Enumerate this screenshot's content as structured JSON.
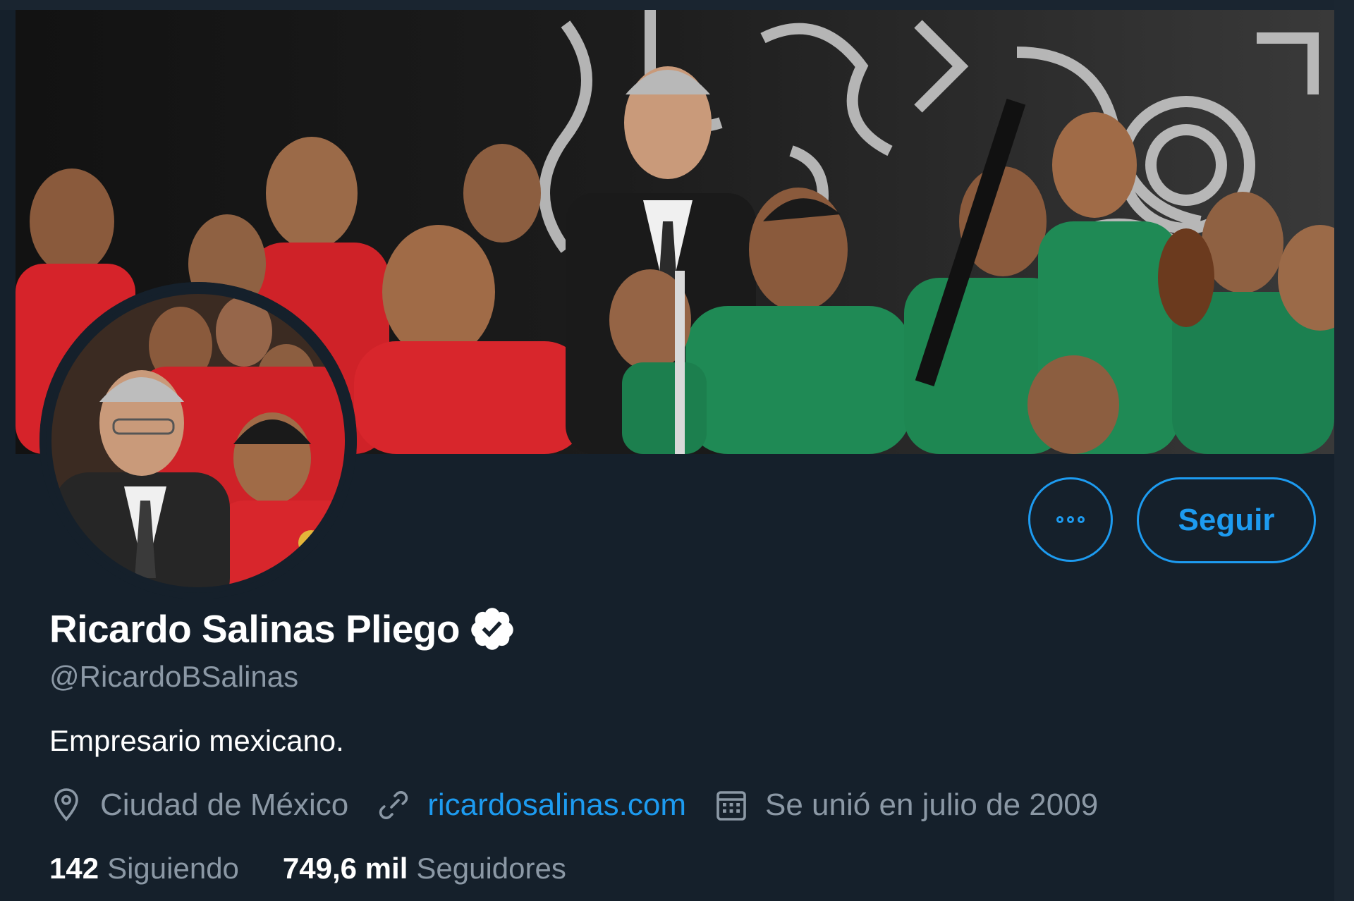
{
  "profile": {
    "display_name": "Ricardo Salinas Pliego",
    "verified": true,
    "handle": "@RicardoBSalinas",
    "bio": "Empresario mexicano.",
    "location": "Ciudad de México",
    "website": "ricardosalinas.com",
    "joined": "Se unió en julio de 2009"
  },
  "actions": {
    "more_icon": "more-options-icon",
    "follow_label": "Seguir"
  },
  "stats": {
    "following_count": "142",
    "following_label": "Siguiendo",
    "followers_count": "749,6 mil",
    "followers_label": "Seguidores"
  },
  "icons": {
    "location": "location-pin-icon",
    "link": "link-icon",
    "calendar": "calendar-icon",
    "verified": "verified-badge-icon"
  },
  "colors": {
    "background": "#15202b",
    "accent": "#1d9bf0",
    "secondary_text": "#8b98a5",
    "primary_text": "#ffffff"
  }
}
